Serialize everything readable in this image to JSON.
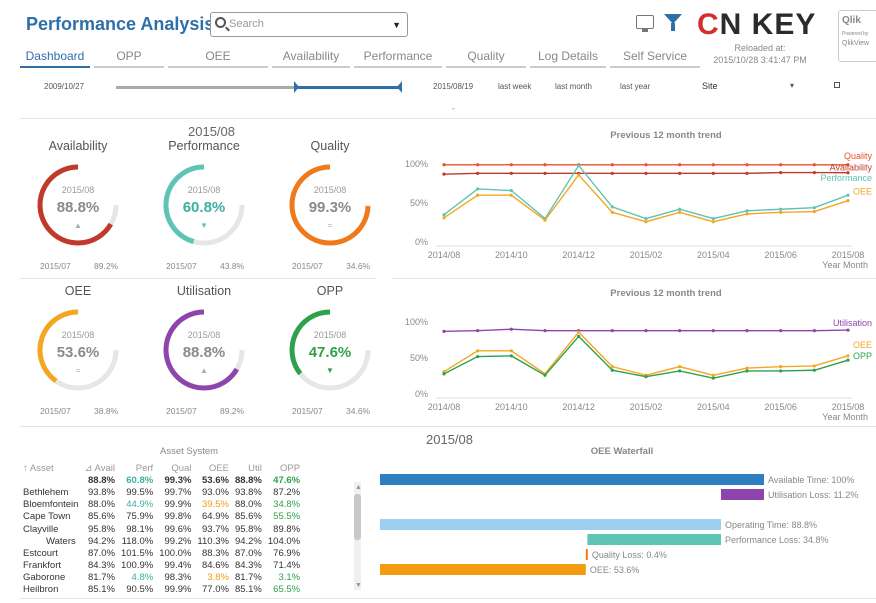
{
  "header": {
    "title": "Performance Analysis",
    "search_placeholder": "Search",
    "brand": {
      "c": "C",
      "rest": "N KEY"
    },
    "reloaded_label": "Reloaded at:",
    "reloaded_time": "2015/10/28  3:41:47 PM",
    "qlik_label": "Qlik",
    "qlik_powered": "Powered by",
    "qlik_sub": "QlikView"
  },
  "tabs": [
    "Dashboard",
    "OPP",
    "OEE",
    "Availability",
    "Performance",
    "Quality",
    "Log Details",
    "Self Service"
  ],
  "active_tab": 0,
  "slider": {
    "start_date": "2009/10/27",
    "end_date": "2015/08/19",
    "quick": [
      "last week",
      "last month",
      "last year"
    ],
    "site_label": "Site"
  },
  "gauge_section_title": "2015/08",
  "gauges": [
    {
      "title": "Availability",
      "period": "2015/08",
      "value": "88.8%",
      "level": 0.888,
      "prev_label": "2015/07",
      "prev_value": "89.2%",
      "trend": "up",
      "color": "#c0392b",
      "value_color": "#8a8a8a"
    },
    {
      "title": "Performance",
      "period": "2015/08",
      "value": "60.8%",
      "level": 0.608,
      "prev_label": "2015/07",
      "prev_value": "43.8%",
      "trend": "down",
      "color": "#5ec4b6",
      "value_color": "#3ab0a0"
    },
    {
      "title": "Quality",
      "period": "2015/08",
      "value": "99.3%",
      "level": 0.993,
      "prev_label": "2015/07",
      "prev_value": "34.6%",
      "trend": "flat",
      "color": "#f07a1a",
      "value_color": "#8a8a8a"
    },
    {
      "title": "OEE",
      "period": "2015/08",
      "value": "53.6%",
      "level": 0.536,
      "prev_label": "2015/07",
      "prev_value": "38.8%",
      "trend": "flat",
      "color": "#f4a623",
      "value_color": "#8a8a8a"
    },
    {
      "title": "Utilisation",
      "period": "2015/08",
      "value": "88.8%",
      "level": 0.888,
      "prev_label": "2015/07",
      "prev_value": "89.2%",
      "trend": "up",
      "color": "#8e44ad",
      "value_color": "#8a8a8a"
    },
    {
      "title": "OPP",
      "period": "2015/08",
      "value": "47.6%",
      "level": 0.476,
      "prev_label": "2015/07",
      "prev_value": "34.6%",
      "trend": "down",
      "color": "#2ea24a",
      "value_color": "#2ea24a"
    }
  ],
  "chart_data": [
    {
      "type": "line",
      "title": "Previous 12 month trend",
      "x": [
        "2014/08",
        "2014/09",
        "2014/10",
        "2014/11",
        "2014/12",
        "2015/01",
        "2015/02",
        "2015/03",
        "2015/04",
        "2015/05",
        "2015/06",
        "2015/07",
        "2015/08"
      ],
      "x_tick_labels": [
        "2014/08",
        "2014/10",
        "2014/12",
        "2015/02",
        "2015/04",
        "2015/06",
        "2015/08"
      ],
      "xlabel": "Year Month",
      "y_tick_labels": [
        "100%",
        "50%",
        "0%"
      ],
      "ylim": [
        0,
        1
      ],
      "series": [
        {
          "name": "Quality",
          "color": "#e8532a",
          "values": [
            0.99,
            0.99,
            0.99,
            0.99,
            0.99,
            0.99,
            0.99,
            0.99,
            0.99,
            0.99,
            0.99,
            0.99,
            0.99
          ]
        },
        {
          "name": "Availability",
          "color": "#c0392b",
          "values": [
            0.87,
            0.88,
            0.88,
            0.88,
            0.88,
            0.88,
            0.88,
            0.88,
            0.88,
            0.88,
            0.89,
            0.89,
            0.888
          ]
        },
        {
          "name": "Performance",
          "color": "#5ec4b6",
          "values": [
            0.35,
            0.68,
            0.66,
            0.3,
            0.98,
            0.45,
            0.3,
            0.42,
            0.3,
            0.4,
            0.42,
            0.44,
            0.6
          ]
        },
        {
          "name": "OEE",
          "color": "#f4a623",
          "values": [
            0.31,
            0.6,
            0.6,
            0.28,
            0.86,
            0.38,
            0.26,
            0.38,
            0.26,
            0.36,
            0.38,
            0.39,
            0.53
          ]
        }
      ]
    },
    {
      "type": "line",
      "title": "Previous 12 month trend",
      "x": [
        "2014/08",
        "2014/09",
        "2014/10",
        "2014/11",
        "2014/12",
        "2015/01",
        "2015/02",
        "2015/03",
        "2015/04",
        "2015/05",
        "2015/06",
        "2015/07",
        "2015/08"
      ],
      "x_tick_labels": [
        "2014/08",
        "2014/10",
        "2014/12",
        "2015/02",
        "2015/04",
        "2015/06",
        "2015/08"
      ],
      "xlabel": "Year Month",
      "y_tick_labels": [
        "100%",
        "50%",
        "0%"
      ],
      "ylim": [
        0,
        1
      ],
      "series": [
        {
          "name": "Utilisation",
          "color": "#8e44ad",
          "values": [
            0.87,
            0.88,
            0.9,
            0.88,
            0.88,
            0.88,
            0.88,
            0.88,
            0.88,
            0.88,
            0.88,
            0.88,
            0.888
          ]
        },
        {
          "name": "OEE",
          "color": "#f4a623",
          "values": [
            0.31,
            0.6,
            0.6,
            0.28,
            0.86,
            0.38,
            0.26,
            0.38,
            0.26,
            0.36,
            0.38,
            0.39,
            0.53
          ]
        },
        {
          "name": "OPP",
          "color": "#2ea24a",
          "values": [
            0.28,
            0.52,
            0.53,
            0.26,
            0.8,
            0.33,
            0.24,
            0.32,
            0.22,
            0.32,
            0.32,
            0.33,
            0.47
          ]
        }
      ]
    },
    {
      "type": "bar",
      "title": "OEE Waterfall",
      "categories": [
        "Available Time",
        "Utilisation Loss",
        "Operating Time",
        "Performance Loss",
        "Quality Loss",
        "OEE"
      ],
      "labels": [
        "Available Time: 100%",
        "Utilisation Loss: 11.2%",
        "Operating Time: 88.8%",
        "Performance Loss: 34.8%",
        "Quality Loss: 0.4%",
        "OEE: 53.6%"
      ],
      "start": [
        0,
        88.8,
        0,
        54.0,
        53.6,
        0
      ],
      "end": [
        100,
        100,
        88.8,
        88.8,
        54.0,
        53.6
      ],
      "colors": [
        "#2e7fc1",
        "#8e44ad",
        "#9fcff0",
        "#5ec4b6",
        "#f07a1a",
        "#f39c12"
      ]
    }
  ],
  "table": {
    "period": "2015/08",
    "group_header": "Asset System",
    "columns": [
      "Asset",
      "Avail",
      "Perf",
      "Qual",
      "OEE",
      "Util",
      "OPP"
    ],
    "sort_asset": "↑",
    "sort_avail": "⊿",
    "total": [
      "",
      "88.8%",
      "60.8%",
      "99.3%",
      "53.6%",
      "88.8%",
      "47.6%"
    ],
    "total_colors": [
      "",
      "",
      "#3ab0a0",
      "",
      "",
      "",
      "#2ea24a"
    ],
    "rows": [
      {
        "cells": [
          "Bethlehem",
          "93.8%",
          "99.5%",
          "99.7%",
          "93.0%",
          "93.8%",
          "87.2%"
        ],
        "colors": [
          "",
          "",
          "",
          "",
          "",
          "",
          ""
        ]
      },
      {
        "cells": [
          "Bloemfontein",
          "88.0%",
          "44.9%",
          "99.9%",
          "39.5%",
          "88.0%",
          "34.8%"
        ],
        "colors": [
          "",
          "",
          "#3ab0a0",
          "",
          "#f39c12",
          "",
          "#2ea24a"
        ]
      },
      {
        "cells": [
          "Cape Town",
          "85.6%",
          "75.9%",
          "99.8%",
          "64.9%",
          "85.6%",
          "55.5%"
        ],
        "colors": [
          "",
          "",
          "",
          "",
          "",
          "",
          "#2ea24a"
        ]
      },
      {
        "cells": [
          "Clayville",
          "95.8%",
          "98.1%",
          "99.6%",
          "93.7%",
          "95.8%",
          "89.8%"
        ],
        "colors": [
          "",
          "",
          "",
          "",
          "",
          "",
          ""
        ]
      },
      {
        "cells": [
          "Waters",
          "94.2%",
          "118.0%",
          "99.2%",
          "110.3%",
          "94.2%",
          "104.0%"
        ],
        "colors": [
          "",
          "",
          "",
          "",
          "",
          "",
          ""
        ]
      },
      {
        "cells": [
          "Estcourt",
          "87.0%",
          "101.5%",
          "100.0%",
          "88.3%",
          "87.0%",
          "76.9%"
        ],
        "colors": [
          "",
          "",
          "",
          "",
          "",
          "",
          ""
        ]
      },
      {
        "cells": [
          "Frankfort",
          "84.3%",
          "100.9%",
          "99.4%",
          "84.6%",
          "84.3%",
          "71.4%"
        ],
        "colors": [
          "",
          "",
          "",
          "",
          "",
          "",
          ""
        ]
      },
      {
        "cells": [
          "Gaborone",
          "81.7%",
          "4.8%",
          "98.3%",
          "3.8%",
          "81.7%",
          "3.1%"
        ],
        "colors": [
          "",
          "",
          "#3ab0a0",
          "",
          "#f39c12",
          "",
          "#2ea24a"
        ]
      },
      {
        "cells": [
          "Heilbron",
          "85.1%",
          "90.5%",
          "99.9%",
          "77.0%",
          "85.1%",
          "65.5%"
        ],
        "colors": [
          "",
          "",
          "",
          "",
          "",
          "",
          "#2ea24a"
        ]
      }
    ]
  }
}
